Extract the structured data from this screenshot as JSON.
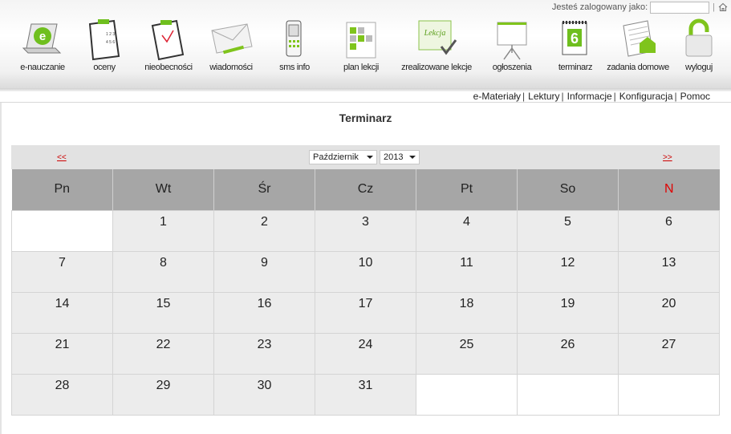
{
  "header": {
    "login_label": "Jesteś zalogowany jako:",
    "login_value": "",
    "nav": [
      {
        "label": "e-nauczanie",
        "icon": "e-learning-laptop-icon"
      },
      {
        "label": "oceny",
        "icon": "grades-clipboard-icon"
      },
      {
        "label": "nieobecności",
        "icon": "absences-clipboard-icon"
      },
      {
        "label": "wiadomości",
        "icon": "messages-envelope-icon"
      },
      {
        "label": "sms info",
        "icon": "sms-phone-icon"
      },
      {
        "label": "plan lekcji",
        "icon": "lesson-plan-icon"
      },
      {
        "label": "zrealizowane lekcje",
        "icon": "completed-lessons-board-icon"
      },
      {
        "label": "ogłoszenia",
        "icon": "announcements-board-icon"
      },
      {
        "label": "terminarz",
        "icon": "calendar-icon"
      },
      {
        "label": "zadania domowe",
        "icon": "homework-notebook-icon"
      },
      {
        "label": "wyloguj",
        "icon": "logout-padlock-icon"
      }
    ]
  },
  "submenu": [
    "e-Materiały",
    "Lektury",
    "Informacje",
    "Konfiguracja",
    "Pomoc"
  ],
  "page_title": "Terminarz",
  "calendar": {
    "prev": "<<",
    "next": ">>",
    "month": "Październik",
    "year": "2013",
    "weekdays": [
      "Pn",
      "Wt",
      "Śr",
      "Cz",
      "Pt",
      "So",
      "N"
    ],
    "weeks": [
      [
        "",
        "1",
        "2",
        "3",
        "4",
        "5",
        "6"
      ],
      [
        "7",
        "8",
        "9",
        "10",
        "11",
        "12",
        "13"
      ],
      [
        "14",
        "15",
        "16",
        "17",
        "18",
        "19",
        "20"
      ],
      [
        "21",
        "22",
        "23",
        "24",
        "25",
        "26",
        "27"
      ],
      [
        "28",
        "29",
        "30",
        "31",
        "",
        "",
        ""
      ]
    ]
  },
  "colors": {
    "accent_green": "#7fc41c",
    "sunday_red": "#e00000",
    "link_red": "#cc0000"
  }
}
